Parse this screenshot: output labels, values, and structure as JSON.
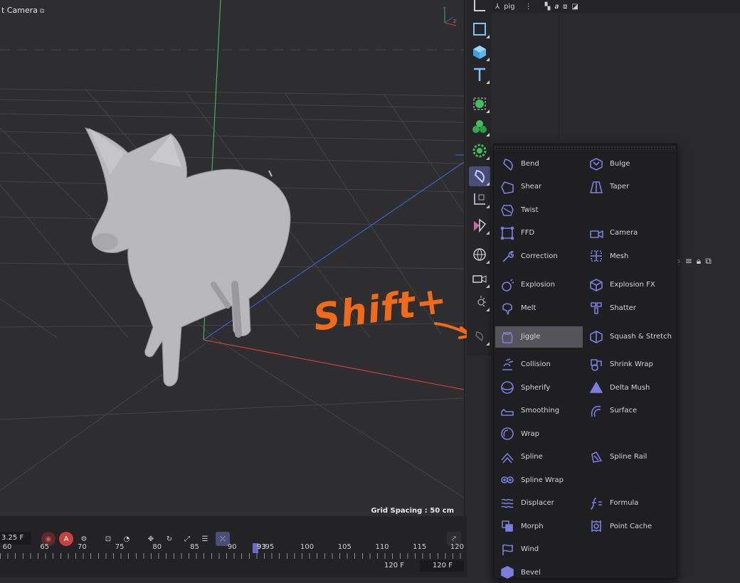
{
  "viewport": {
    "title": "t Camera",
    "grid_spacing": "Grid Spacing : 50 cm"
  },
  "right_panel": {
    "object_name": "pig"
  },
  "annotation": {
    "text": "Shift+"
  },
  "deformer_menu": {
    "items": [
      {
        "label": "Bend",
        "icon": "bend-icon"
      },
      {
        "label": "Bulge",
        "icon": "bulge-icon"
      },
      {
        "label": "Shear",
        "icon": "shear-icon"
      },
      {
        "label": "Taper",
        "icon": "taper-icon"
      },
      {
        "label": "Twist",
        "icon": "twist-icon"
      },
      {
        "label": "FFD",
        "icon": "ffd-icon"
      },
      {
        "label": "Camera",
        "icon": "camera-icon"
      },
      {
        "label": "Correction",
        "icon": "correction-icon"
      },
      {
        "label": "Mesh",
        "icon": "mesh-icon"
      },
      {
        "label": "Explosion",
        "icon": "explosion-icon"
      },
      {
        "label": "Explosion FX",
        "icon": "explosion-fx-icon"
      },
      {
        "label": "Melt",
        "icon": "melt-icon"
      },
      {
        "label": "Shatter",
        "icon": "shatter-icon"
      },
      {
        "label": "Jiggle",
        "icon": "jiggle-icon"
      },
      {
        "label": "Squash & Stretch",
        "icon": "squash-stretch-icon"
      },
      {
        "label": "Collision",
        "icon": "collision-icon"
      },
      {
        "label": "Shrink Wrap",
        "icon": "shrink-wrap-icon"
      },
      {
        "label": "Spherify",
        "icon": "spherify-icon"
      },
      {
        "label": "Delta Mush",
        "icon": "delta-mush-icon"
      },
      {
        "label": "Smoothing",
        "icon": "smoothing-icon"
      },
      {
        "label": "Surface",
        "icon": "surface-icon"
      },
      {
        "label": "Wrap",
        "icon": "wrap-icon"
      },
      {
        "label": "Spline",
        "icon": "spline-icon"
      },
      {
        "label": "Spline Rail",
        "icon": "spline-rail-icon"
      },
      {
        "label": "Spline Wrap",
        "icon": "spline-wrap-icon"
      },
      {
        "label": "Displacer",
        "icon": "displacer-icon"
      },
      {
        "label": "Formula",
        "icon": "formula-icon"
      },
      {
        "label": "Morph",
        "icon": "morph-icon"
      },
      {
        "label": "Point Cache",
        "icon": "point-cache-icon"
      },
      {
        "label": "Wind",
        "icon": "wind-icon"
      },
      {
        "label": "Bevel",
        "icon": "bevel-icon"
      }
    ],
    "selected": "Jiggle"
  },
  "timeline": {
    "current_frame_field": "3.25 F",
    "record_label": "A",
    "ruler_ticks": [
      "60",
      "65",
      "70",
      "75",
      "80",
      "85",
      "90",
      "95",
      "100",
      "105",
      "110",
      "115",
      "120"
    ],
    "playhead_label": "93",
    "end_frame": "120 F",
    "max_frame": "120 F"
  },
  "colors": {
    "accent": "#7a7ee0",
    "annotation": "#f06a1a",
    "axis_x": "#c84040",
    "axis_y": "#3fae6a",
    "axis_z": "#3a5fd0"
  }
}
